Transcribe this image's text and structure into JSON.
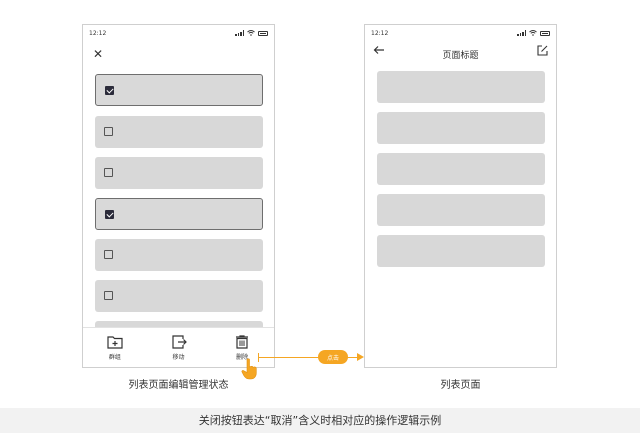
{
  "status_bar": {
    "time": "12:12"
  },
  "left_phone": {
    "nav": {
      "close_icon": "close-icon"
    },
    "items": [
      {
        "checked": true
      },
      {
        "checked": false
      },
      {
        "checked": false
      },
      {
        "checked": true
      },
      {
        "checked": false
      },
      {
        "checked": false
      }
    ],
    "toolbar": [
      {
        "label": "群组",
        "icon": "folder-add-icon"
      },
      {
        "label": "移动",
        "icon": "move-icon"
      },
      {
        "label": "删除",
        "icon": "trash-icon"
      }
    ],
    "caption": "列表页面编辑管理状态"
  },
  "right_phone": {
    "nav": {
      "title": "页面标题",
      "back_icon": "back-arrow-icon",
      "edit_icon": "edit-icon"
    },
    "caption": "列表页面"
  },
  "connector": {
    "label": "点击",
    "color": "#f5a623"
  },
  "footer_caption": "关闭按钮表达“取消”含义时相对应的操作逻辑示例"
}
